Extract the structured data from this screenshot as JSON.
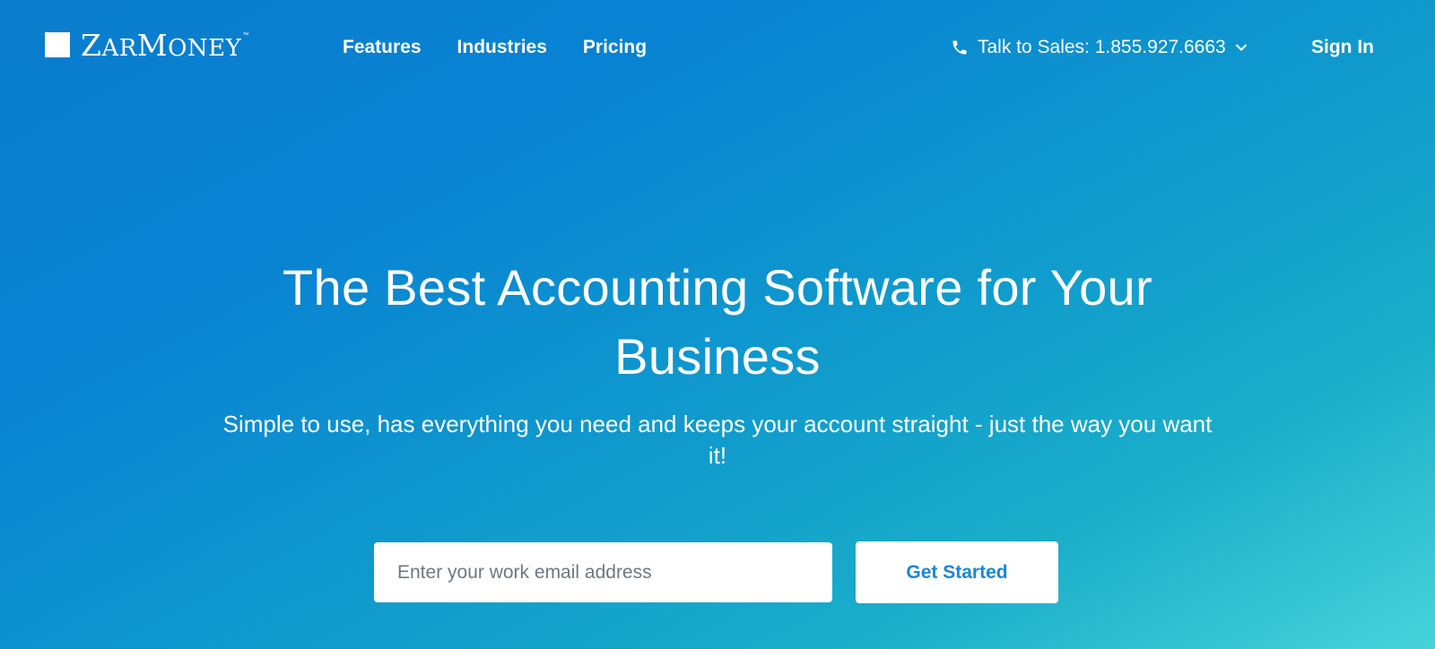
{
  "brand": {
    "logo_text_parts": [
      "Z",
      "AR",
      "M",
      "ONEY"
    ],
    "trademark": "™",
    "icon": "square-logo-icon"
  },
  "nav": {
    "links": [
      "Features",
      "Industries",
      "Pricing"
    ],
    "sales_label": "Talk to Sales: 1.855.927.6663",
    "sales_icon": "phone-icon",
    "sales_chevron_icon": "chevron-down-icon",
    "sign_in": "Sign In"
  },
  "hero": {
    "title_line1": "The Best Accounting Software for Your",
    "title_line2": "Business",
    "subtitle": "Simple to use, has everything you need and keeps your account straight - just the way you want it!",
    "email_placeholder": "Enter your work email address",
    "email_value": "",
    "cta_label": "Get Started"
  },
  "colors": {
    "gradient_start": "#0a7ccc",
    "gradient_end": "#48d3da",
    "cta_text": "#1a86d6",
    "text": "#ffffff"
  }
}
